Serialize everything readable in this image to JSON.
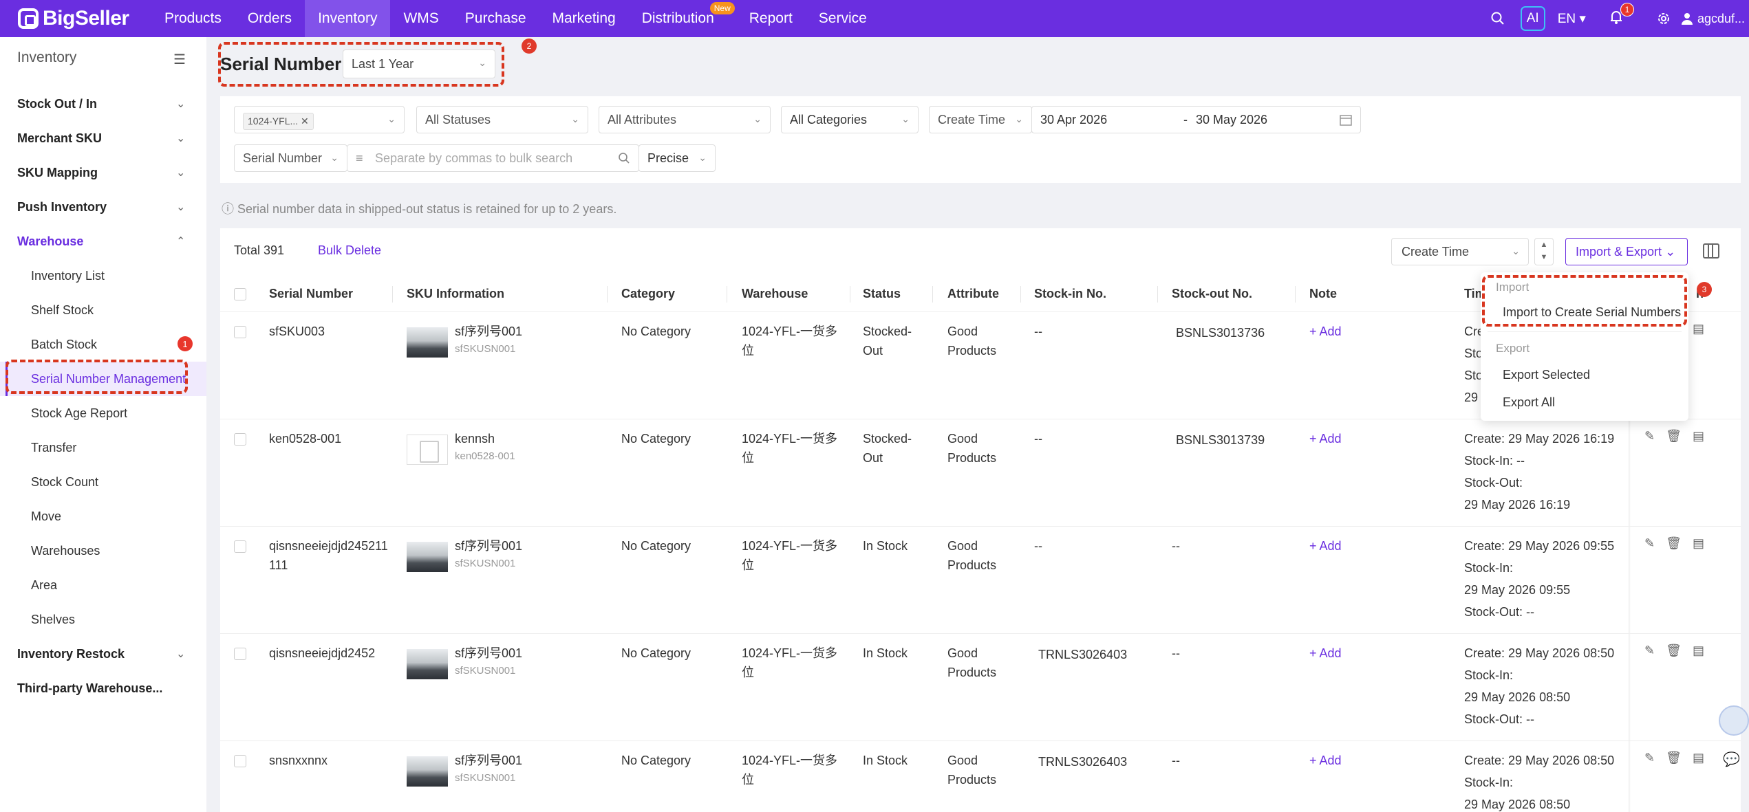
{
  "nav": {
    "logo": "BigSeller",
    "items": [
      {
        "label": "Products"
      },
      {
        "label": "Orders"
      },
      {
        "label": "Inventory"
      },
      {
        "label": "WMS"
      },
      {
        "label": "Purchase"
      },
      {
        "label": "Marketing"
      },
      {
        "label": "Distribution"
      },
      {
        "label": "Report"
      },
      {
        "label": "Service"
      }
    ],
    "new_badge": "New",
    "ai_label": "AI",
    "lang": "EN",
    "bell_count": "1",
    "user": "agcduf..."
  },
  "sidebar": {
    "title": "Inventory",
    "groups": [
      {
        "label": "Stock Out / In"
      },
      {
        "label": "Merchant SKU"
      },
      {
        "label": "SKU Mapping"
      },
      {
        "label": "Push Inventory"
      },
      {
        "label": "Warehouse"
      },
      {
        "label": "Inventory Restock"
      },
      {
        "label": "Third-party Warehouse..."
      }
    ],
    "warehouse_items": [
      {
        "label": "Inventory List"
      },
      {
        "label": "Shelf Stock"
      },
      {
        "label": "Batch Stock"
      },
      {
        "label": "Serial Number Management"
      },
      {
        "label": "Stock Age Report"
      },
      {
        "label": "Transfer"
      },
      {
        "label": "Stock Count"
      },
      {
        "label": "Move"
      },
      {
        "label": "Warehouses"
      },
      {
        "label": "Area"
      },
      {
        "label": "Shelves"
      }
    ],
    "badge_batch": "1"
  },
  "marks": {
    "m1": "1",
    "m2": "2",
    "m3": "3"
  },
  "page": {
    "title": "Serial Number",
    "range": "Last 1 Year"
  },
  "filters": {
    "warehouse_tag": "1024-YFL...",
    "status": "All Statuses",
    "attributes": "All Attributes",
    "categories": "All Categories",
    "time_type": "Create Time",
    "date_from": "30 Apr 2026",
    "date_sep": "-",
    "date_to": "30 May 2026",
    "search_field": "Serial Number",
    "search_placeholder": "Separate by commas to bulk search",
    "match_mode": "Precise"
  },
  "info": "Serial number data in shipped-out status is retained for up to 2 years.",
  "toolbar": {
    "total": "Total 391",
    "bulk_delete": "Bulk Delete",
    "sort": "Create Time",
    "import_export": "Import & Export"
  },
  "table": {
    "headers": [
      "Serial Number",
      "SKU Information",
      "Category",
      "Warehouse",
      "Status",
      "Attribute",
      "Stock-in No.",
      "Stock-out No.",
      "Note",
      "Tim",
      "n"
    ],
    "add_label": "+ Add",
    "rows": [
      {
        "serial": "sfSKU003",
        "sku_name": "sf序列号001",
        "sku_code": "sfSKUSN001",
        "category": "No Category",
        "warehouse": "1024-YFL-一货多位",
        "status": "Stocked-Out",
        "attribute": "Good Products",
        "stock_in": "--",
        "stock_out": "BSNLS3013736",
        "t1": "Crea",
        "t2": "Sto",
        "t3": "Sto",
        "t4": "29"
      },
      {
        "serial": "ken0528-001",
        "sku_name": "kennsh",
        "sku_code": "ken0528-001",
        "category": "No Category",
        "warehouse": "1024-YFL-一货多位",
        "status": "Stocked-Out",
        "attribute": "Good Products",
        "stock_in": "--",
        "stock_out": "BSNLS3013739",
        "t1": "Create: 29 May 2026 16:19",
        "t2": "Stock-In: --",
        "t3": "Stock-Out:",
        "t4": "29 May 2026 16:19"
      },
      {
        "serial": "qisnsneeiejdjd245211111",
        "sku_name": "sf序列号001",
        "sku_code": "sfSKUSN001",
        "category": "No Category",
        "warehouse": "1024-YFL-一货多位",
        "status": "In Stock",
        "attribute": "Good Products",
        "stock_in": "--",
        "stock_out": "--",
        "t1": "Create: 29 May 2026 09:55",
        "t2": "Stock-In:",
        "t3": "29 May 2026 09:55",
        "t4": "Stock-Out: --"
      },
      {
        "serial": "qisnsneeiejdjd2452",
        "sku_name": "sf序列号001",
        "sku_code": "sfSKUSN001",
        "category": "No Category",
        "warehouse": "1024-YFL-一货多位",
        "status": "In Stock",
        "attribute": "Good Products",
        "stock_in": "TRNLS3026403",
        "stock_out": "--",
        "t1": "Create: 29 May 2026 08:50",
        "t2": "Stock-In:",
        "t3": "29 May 2026 08:50",
        "t4": "Stock-Out: --"
      },
      {
        "serial": "snsnxxnnx",
        "sku_name": "sf序列号001",
        "sku_code": "sfSKUSN001",
        "category": "No Category",
        "warehouse": "1024-YFL-一货多位",
        "status": "In Stock",
        "attribute": "Good Products",
        "stock_in": "TRNLS3026403",
        "stock_out": "--",
        "t1": "Create: 29 May 2026 08:50",
        "t2": "Stock-In:",
        "t3": "29 May 2026 08:50",
        "t4": ""
      }
    ]
  },
  "dropdown": {
    "import_group": "Import",
    "import_create": "Import to Create Serial Numbers",
    "export_group": "Export",
    "export_selected": "Export Selected",
    "export_all": "Export All"
  },
  "colors": {
    "brand": "#6a2ee0",
    "highlight": "#d8361f"
  }
}
